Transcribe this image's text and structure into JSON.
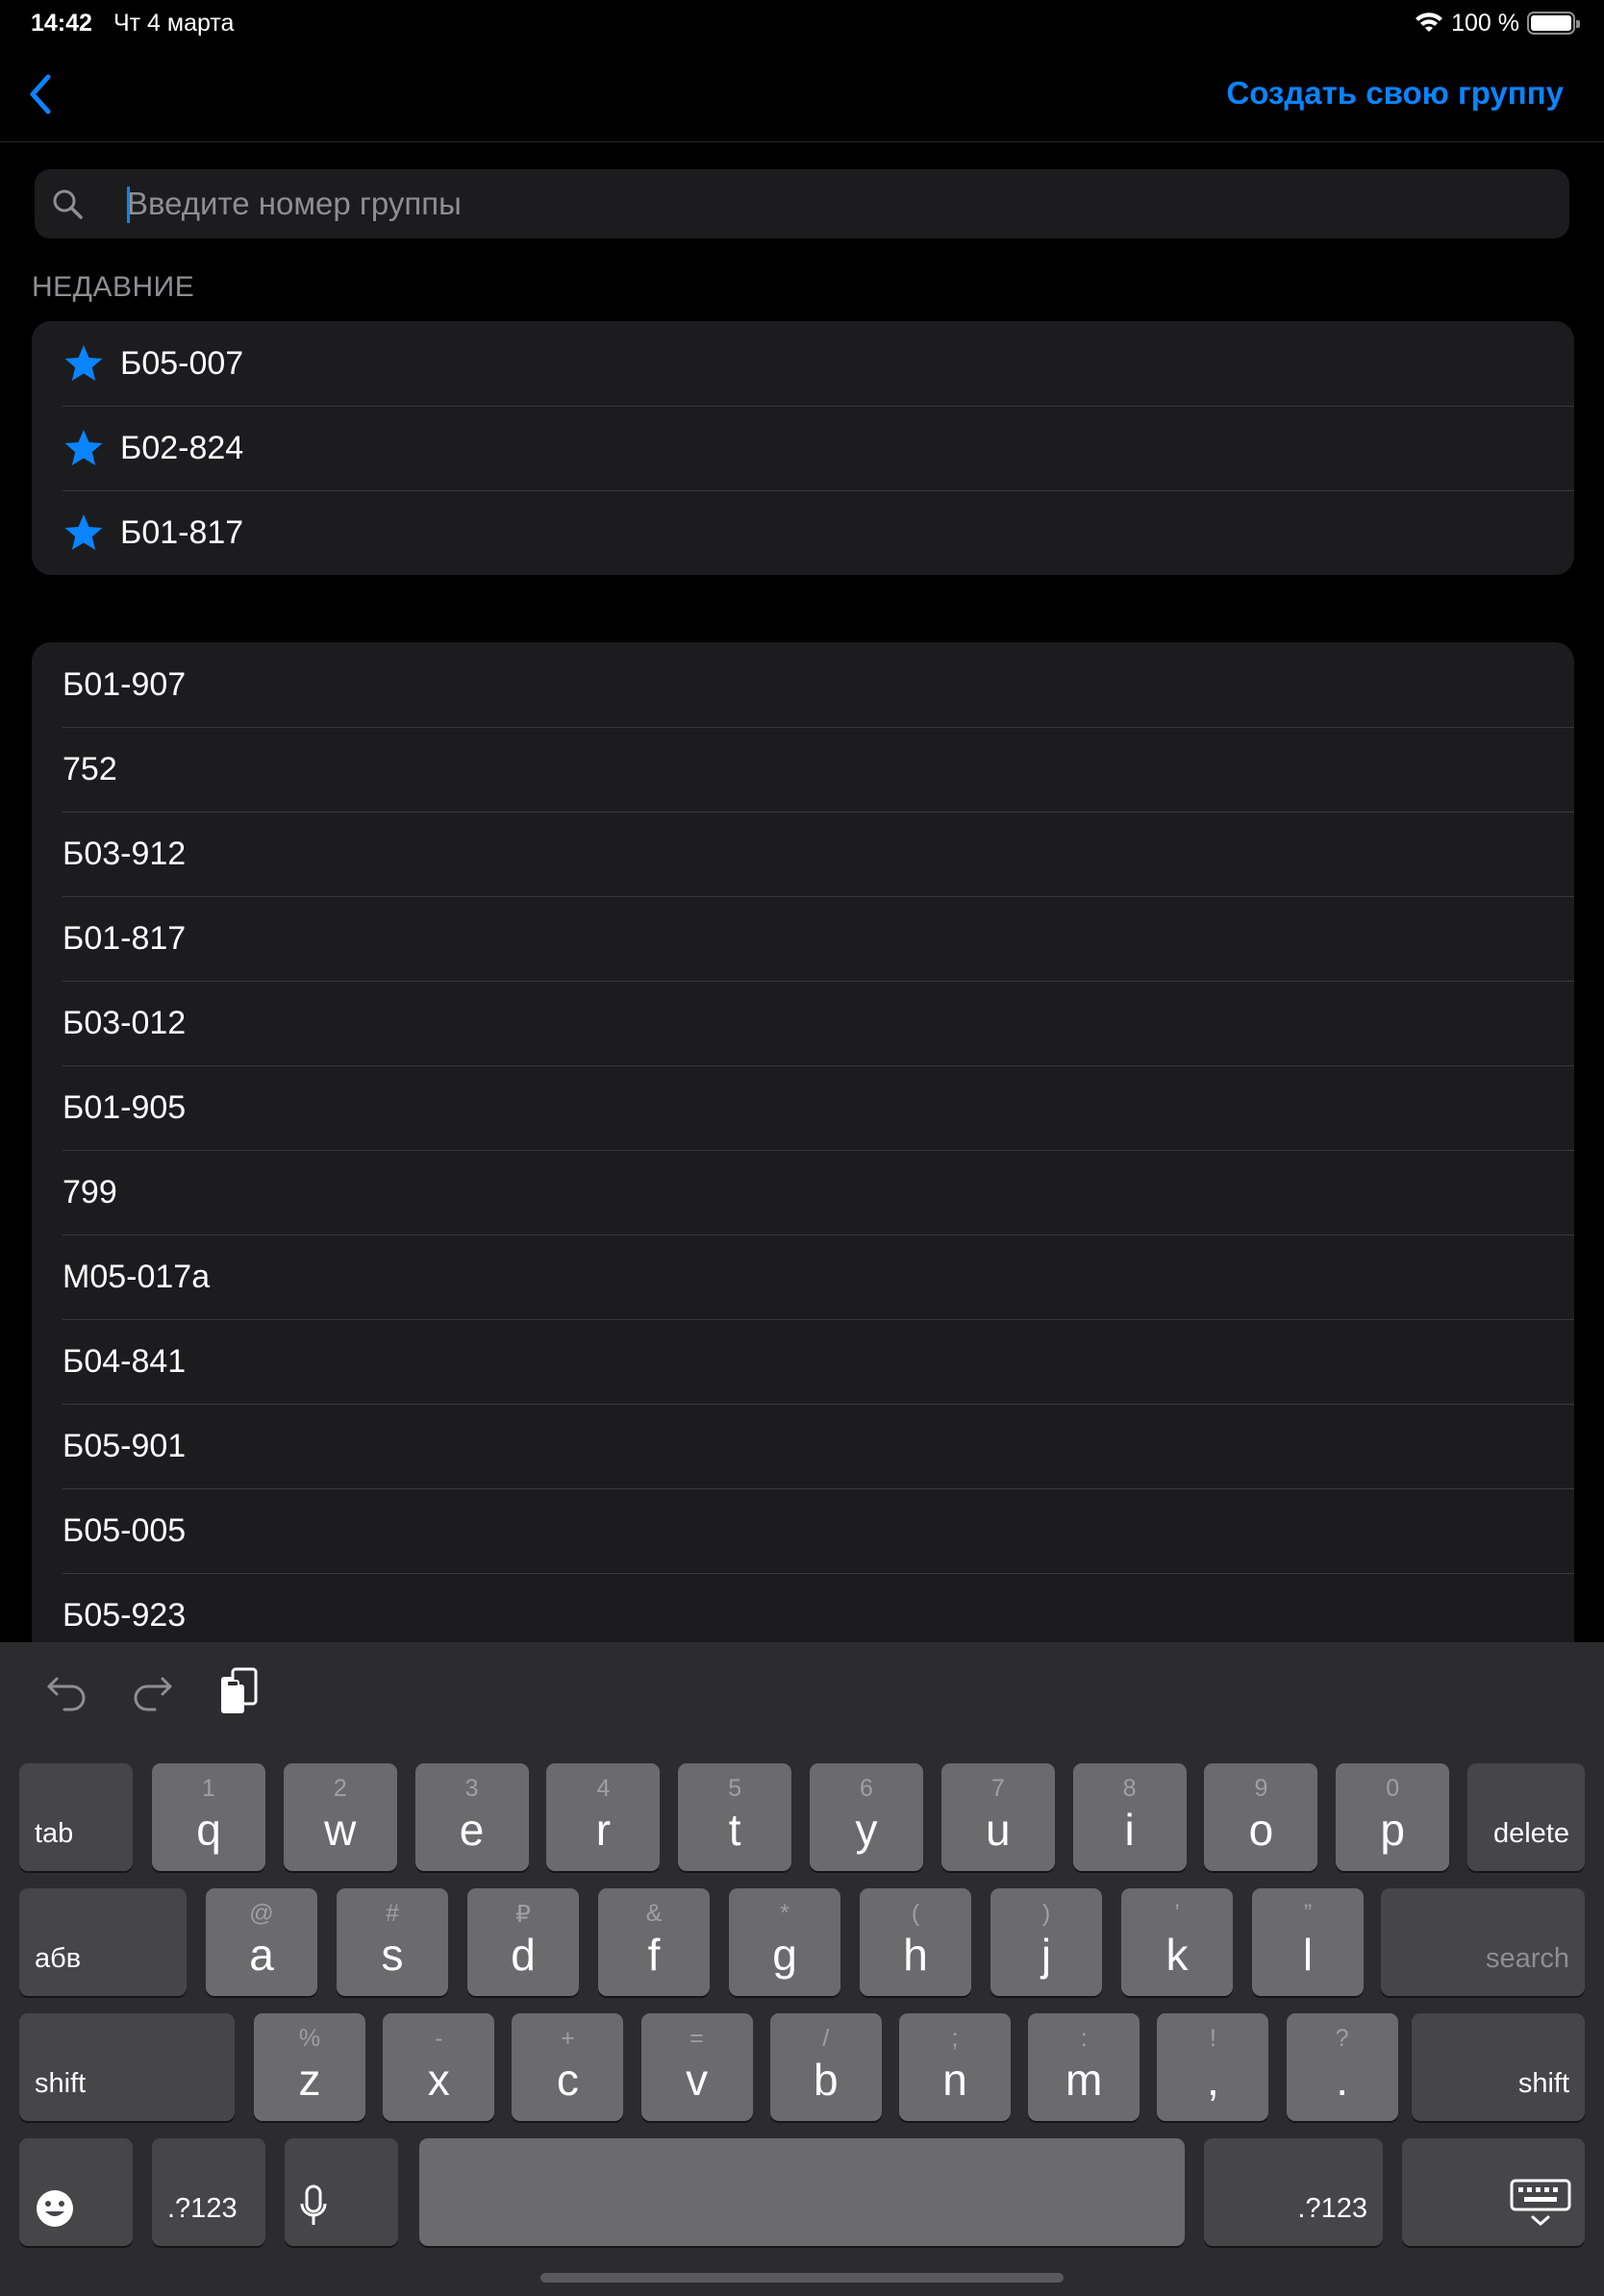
{
  "status_bar": {
    "time": "14:42",
    "date": "Чт 4 марта",
    "battery": "100 %"
  },
  "nav": {
    "back_icon": "chevron-left-icon",
    "action": "Создать свою группу"
  },
  "search": {
    "placeholder": "Введите номер группы",
    "value": ""
  },
  "recent": {
    "header": "НЕДАВНИЕ",
    "items": [
      {
        "label": "Б05-007",
        "icon": "star-icon"
      },
      {
        "label": "Б02-824",
        "icon": "star-icon"
      },
      {
        "label": "Б01-817",
        "icon": "star-icon"
      }
    ]
  },
  "groups": {
    "items": [
      "Б01-907",
      "752",
      "Б03-912",
      "Б01-817",
      "Б03-012",
      "Б01-905",
      "799",
      "М05-017а",
      "Б04-841",
      "Б05-901",
      "Б05-005",
      "Б05-923"
    ]
  },
  "keyboard": {
    "row1": {
      "tab": "tab",
      "delete": "delete",
      "keys": [
        [
          "1",
          "q"
        ],
        [
          "2",
          "w"
        ],
        [
          "3",
          "e"
        ],
        [
          "4",
          "r"
        ],
        [
          "5",
          "t"
        ],
        [
          "6",
          "y"
        ],
        [
          "7",
          "u"
        ],
        [
          "8",
          "i"
        ],
        [
          "9",
          "o"
        ],
        [
          "0",
          "p"
        ]
      ]
    },
    "row2": {
      "lang": "абв",
      "search": "search",
      "keys": [
        [
          "@",
          "a"
        ],
        [
          "#",
          "s"
        ],
        [
          "₽",
          "d"
        ],
        [
          "&",
          "f"
        ],
        [
          "*",
          "g"
        ],
        [
          "(",
          "h"
        ],
        [
          ")",
          "j"
        ],
        [
          "’",
          "k"
        ],
        [
          "”",
          "l"
        ]
      ]
    },
    "row3": {
      "shift": "shift",
      "keys": [
        [
          "%",
          "z"
        ],
        [
          "-",
          "x"
        ],
        [
          "+",
          "c"
        ],
        [
          "=",
          "v"
        ],
        [
          "/",
          "b"
        ],
        [
          ";",
          "n"
        ],
        [
          ":",
          "m"
        ],
        [
          "!",
          ","
        ],
        [
          "?",
          "."
        ]
      ]
    },
    "row4": {
      "numbers": ".?123"
    },
    "colors": {
      "key": "#6b6b6d",
      "dark_key": "#464648",
      "background": "#2c2c2e",
      "accent": "#0a84ff"
    }
  }
}
